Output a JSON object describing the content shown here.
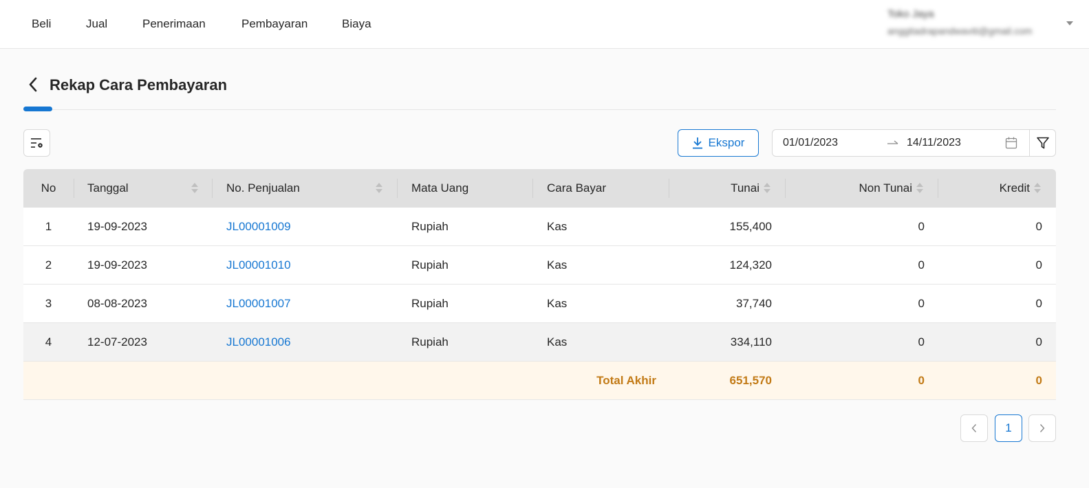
{
  "nav": {
    "items": [
      "Beli",
      "Jual",
      "Penerimaan",
      "Pembayaran",
      "Biaya"
    ]
  },
  "user": {
    "name": "Toko Jaya",
    "email": "anggitadrapandwaviti@gmail.com"
  },
  "page": {
    "title": "Rekap Cara Pembayaran"
  },
  "toolbar": {
    "export_label": "Ekspor",
    "date_start": "01/01/2023",
    "date_end": "14/11/2023"
  },
  "table": {
    "columns": {
      "no": "No",
      "tanggal": "Tanggal",
      "no_penjualan": "No. Penjualan",
      "mata_uang": "Mata Uang",
      "cara_bayar": "Cara Bayar",
      "tunai": "Tunai",
      "non_tunai": "Non Tunai",
      "kredit": "Kredit"
    },
    "rows": [
      {
        "no": "1",
        "tanggal": "19-09-2023",
        "no_penjualan": "JL00001009",
        "mata_uang": "Rupiah",
        "cara_bayar": "Kas",
        "tunai": "155,400",
        "non_tunai": "0",
        "kredit": "0"
      },
      {
        "no": "2",
        "tanggal": "19-09-2023",
        "no_penjualan": "JL00001010",
        "mata_uang": "Rupiah",
        "cara_bayar": "Kas",
        "tunai": "124,320",
        "non_tunai": "0",
        "kredit": "0"
      },
      {
        "no": "3",
        "tanggal": "08-08-2023",
        "no_penjualan": "JL00001007",
        "mata_uang": "Rupiah",
        "cara_bayar": "Kas",
        "tunai": "37,740",
        "non_tunai": "0",
        "kredit": "0"
      },
      {
        "no": "4",
        "tanggal": "12-07-2023",
        "no_penjualan": "JL00001006",
        "mata_uang": "Rupiah",
        "cara_bayar": "Kas",
        "tunai": "334,110",
        "non_tunai": "0",
        "kredit": "0"
      }
    ],
    "total": {
      "label": "Total Akhir",
      "tunai": "651,570",
      "non_tunai": "0",
      "kredit": "0"
    }
  },
  "pagination": {
    "current_page": "1"
  },
  "colors": {
    "accent": "#1677d2",
    "total_text": "#c27a16",
    "total_bg": "#fff7eb",
    "header_bg": "#e0e0e0"
  }
}
